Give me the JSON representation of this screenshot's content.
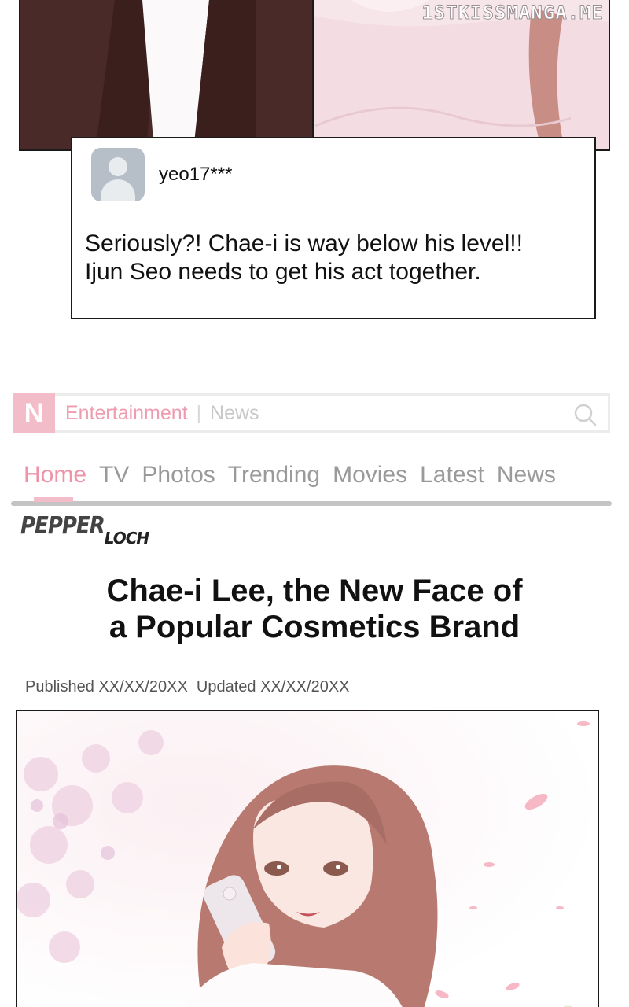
{
  "watermark": "1STKISSMANGA.ME",
  "comment": {
    "username": "yeo17***",
    "text_line1": "Seriously?! Chae-i is way below his level!!",
    "text_line2": "Ijun Seo needs to get his act together."
  },
  "news_site": {
    "logo_letter": "N",
    "name": "Entertainment",
    "separator": "|",
    "section": "News",
    "nav": [
      "Home",
      "TV",
      "Photos",
      "Trending",
      "Movies",
      "Latest",
      "News"
    ],
    "active_nav": "Home",
    "publisher_part1": "PEPPER",
    "publisher_part2": "LOCH"
  },
  "article": {
    "headline_line1": "Chae-i Lee, the New Face of",
    "headline_line2": "a Popular Cosmetics Brand",
    "published": "Published XX/XX/20XX",
    "updated": "Updated XX/XX/20XX"
  },
  "colors": {
    "accent_pink": "#ef93aa",
    "logo_pink": "#f3bcc9",
    "nav_gray": "#9a9a9a"
  }
}
